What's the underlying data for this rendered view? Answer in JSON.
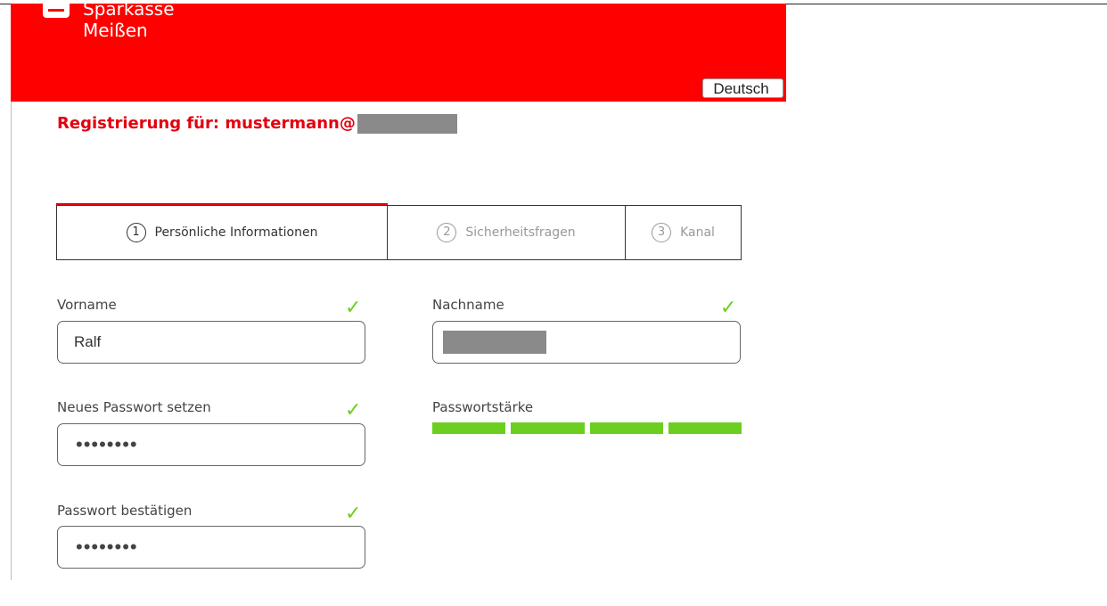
{
  "header": {
    "brand_line1": "Sparkasse",
    "brand_line2": "Meißen",
    "language_button": "Deutsch",
    "color": "#ff0000"
  },
  "registration": {
    "title": "Registrierung für: mustermann@"
  },
  "steps": [
    {
      "number": "1",
      "label": "Persönliche Informationen",
      "state": "active"
    },
    {
      "number": "2",
      "label": "Sicherheitsfragen",
      "state": "inactive"
    },
    {
      "number": "3",
      "label": "Kanal",
      "state": "inactive"
    }
  ],
  "form": {
    "vorname": {
      "label": "Vorname",
      "value": "Ralf"
    },
    "nachname": {
      "label": "Nachname"
    },
    "new_password": {
      "label": "Neues Passwort setzen",
      "value": "••••••••"
    },
    "password_strength": {
      "label": "Passwortstärke",
      "level": 4,
      "max": 4
    },
    "confirm_password": {
      "label": "Passwort bestätigen",
      "value": "••••••••"
    }
  },
  "icons": {
    "valid": "checkmark-icon",
    "check_glyph": "✓"
  },
  "colors": {
    "accent": "#e3000f",
    "valid": "#6ccf1f"
  }
}
